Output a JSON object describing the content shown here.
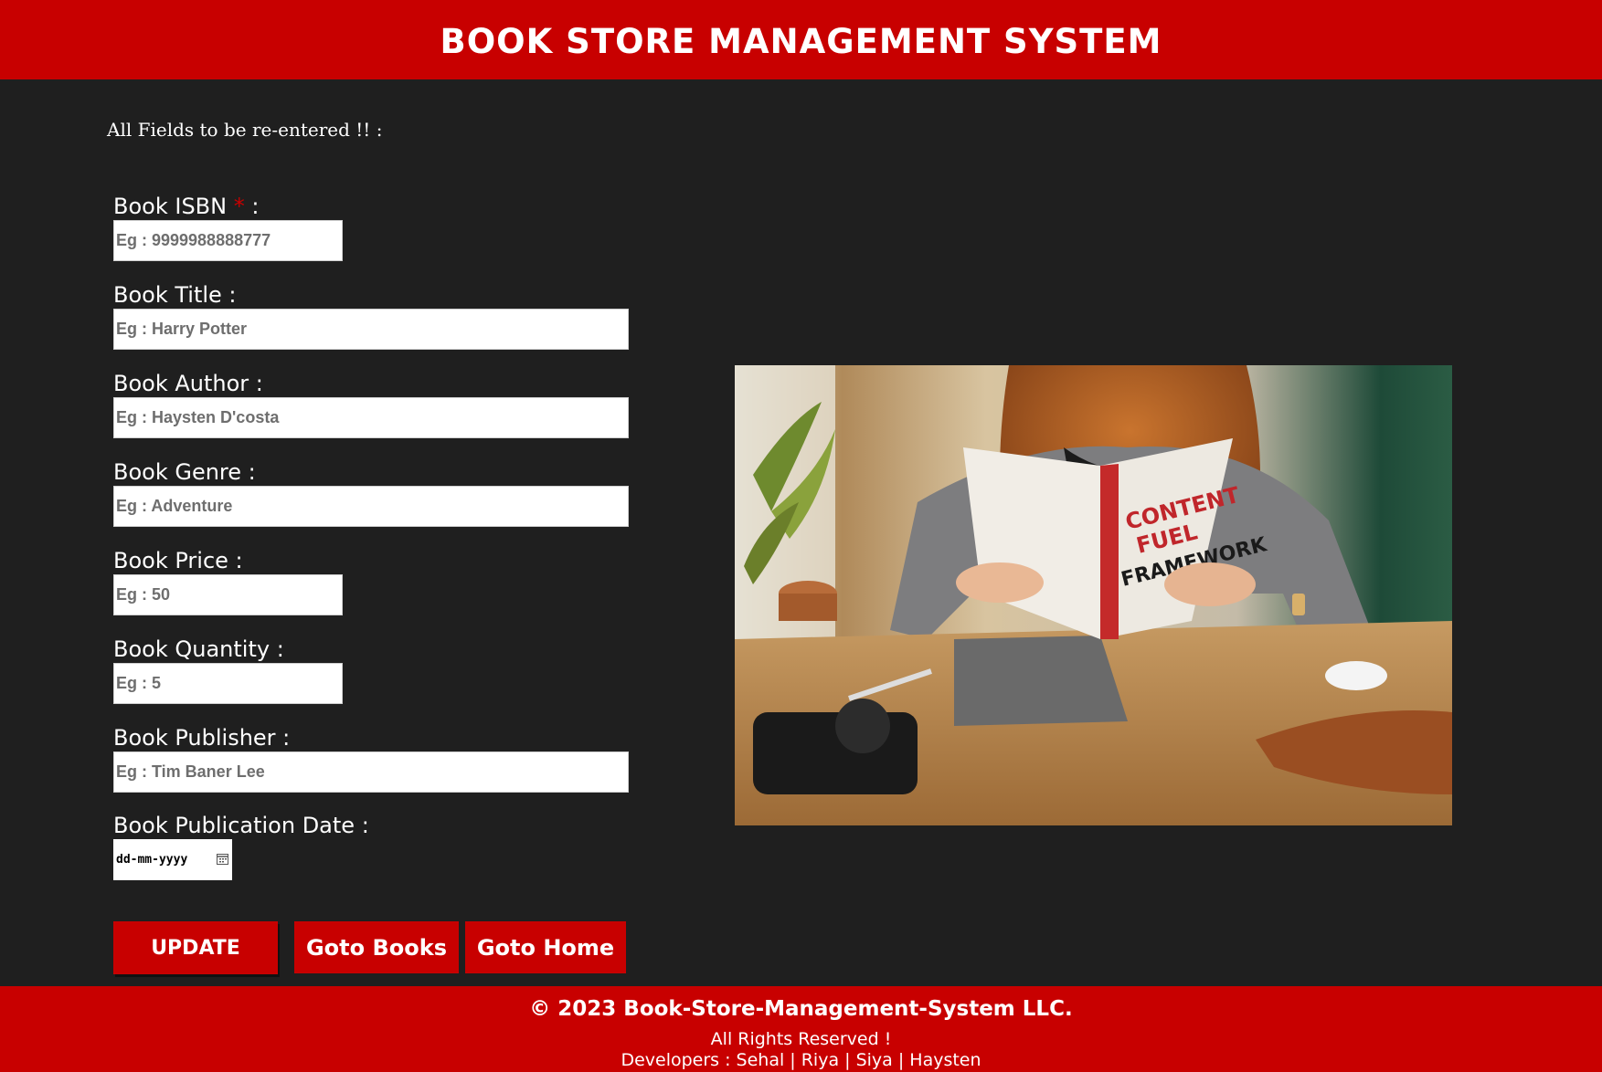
{
  "header": {
    "title": "BOOK STORE MANAGEMENT SYSTEM",
    "bg_color": "#c80000"
  },
  "notice": "All Fields to be re-entered !! :",
  "form": {
    "isbn": {
      "label": "Book ISBN",
      "required_mark": "*",
      "suffix": ":",
      "placeholder": "Eg : 9999988888777"
    },
    "title": {
      "label": "Book Title :",
      "placeholder": "Eg : Harry Potter"
    },
    "author": {
      "label": "Book Author :",
      "placeholder": "Eg : Haysten D'costa"
    },
    "genre": {
      "label": "Book Genre :",
      "placeholder": "Eg : Adventure"
    },
    "price": {
      "label": "Book Price :",
      "placeholder": "Eg : 50"
    },
    "quantity": {
      "label": "Book Quantity :",
      "placeholder": "Eg : 5"
    },
    "publisher": {
      "label": "Book Publisher :",
      "placeholder": "Eg : Tim Baner Lee"
    },
    "pub_date": {
      "label": "Book Publication Date :",
      "placeholder": "dd-mm-yyyy"
    }
  },
  "buttons": {
    "update": "UPDATE",
    "goto_books": "Goto Books",
    "goto_home": "Goto Home"
  },
  "image": {
    "book_cover_text": [
      "CONTENT",
      "FUEL",
      "FRAMEWORK"
    ]
  },
  "footer": {
    "copyright": "© 2023 Book-Store-Management-System LLC.",
    "rights": "All Rights Reserved !",
    "developers": "Developers : Sehal | Riya | Siya | Haysten"
  },
  "colors": {
    "accent": "#c80000",
    "background": "#1f1f1f"
  }
}
